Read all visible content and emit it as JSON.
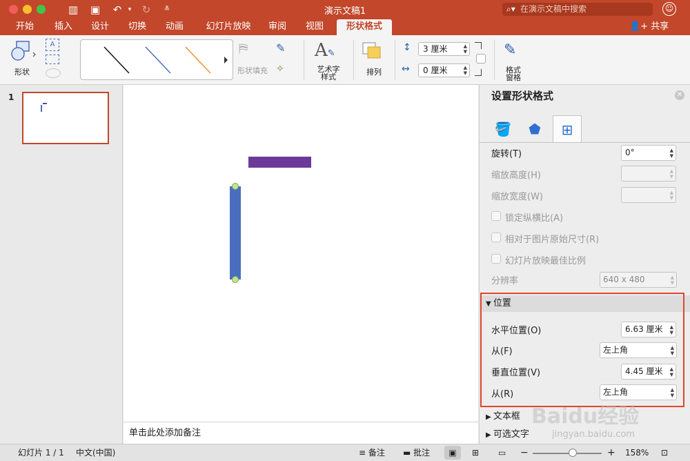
{
  "window": {
    "title": "演示文稿1"
  },
  "search": {
    "placeholder": "在演示文稿中搜索"
  },
  "tabs": [
    "开始",
    "插入",
    "设计",
    "切换",
    "动画",
    "幻灯片放映",
    "审阅",
    "视图",
    "形状格式"
  ],
  "share_label": "共享",
  "ribbon": {
    "shape_label": "形状",
    "shape_fill_label": "形状填充",
    "wordart_label": "艺术字\n样式",
    "arrange_label": "排列",
    "height_value": "3 厘米",
    "width_value": "0 厘米",
    "format_pane_label": "格式\n窗格"
  },
  "slide_pane": {
    "slide_number": "1"
  },
  "notes": {
    "placeholder": "单击此处添加备注"
  },
  "panel": {
    "title": "设置形状格式",
    "rotation_label": "旋转(T)",
    "rotation_value": "0°",
    "scale_height_label": "缩放高度(H)",
    "scale_width_label": "缩放宽度(W)",
    "lock_aspect_label": "锁定纵横比(A)",
    "relative_original_label": "相对于图片原始尺寸(R)",
    "best_scale_label": "幻灯片放映最佳比例",
    "resolution_label": "分辨率",
    "resolution_value": "640 x 480",
    "position_section": "位置",
    "horizontal_label": "水平位置(O)",
    "horizontal_value": "6.63 厘米",
    "from_h_label": "从(F)",
    "from_h_value": "左上角",
    "vertical_label": "垂直位置(V)",
    "vertical_value": "4.45 厘米",
    "from_v_label": "从(R)",
    "from_v_value": "左上角",
    "textbox_section": "文本框",
    "alt_text_section": "可选文字"
  },
  "statusbar": {
    "slide_info": "幻灯片 1 / 1",
    "language": "中文(中国)",
    "notes_label": "备注",
    "comments_label": "批注",
    "zoom": "158%"
  },
  "watermark": {
    "brand": "Baidu经验",
    "url": "jingyan.baidu.com"
  },
  "colors": {
    "accent": "#c2472b",
    "purple_shape": "#6b3a99",
    "blue_shape": "#4a6ebf",
    "highlight": "#e0452a"
  }
}
